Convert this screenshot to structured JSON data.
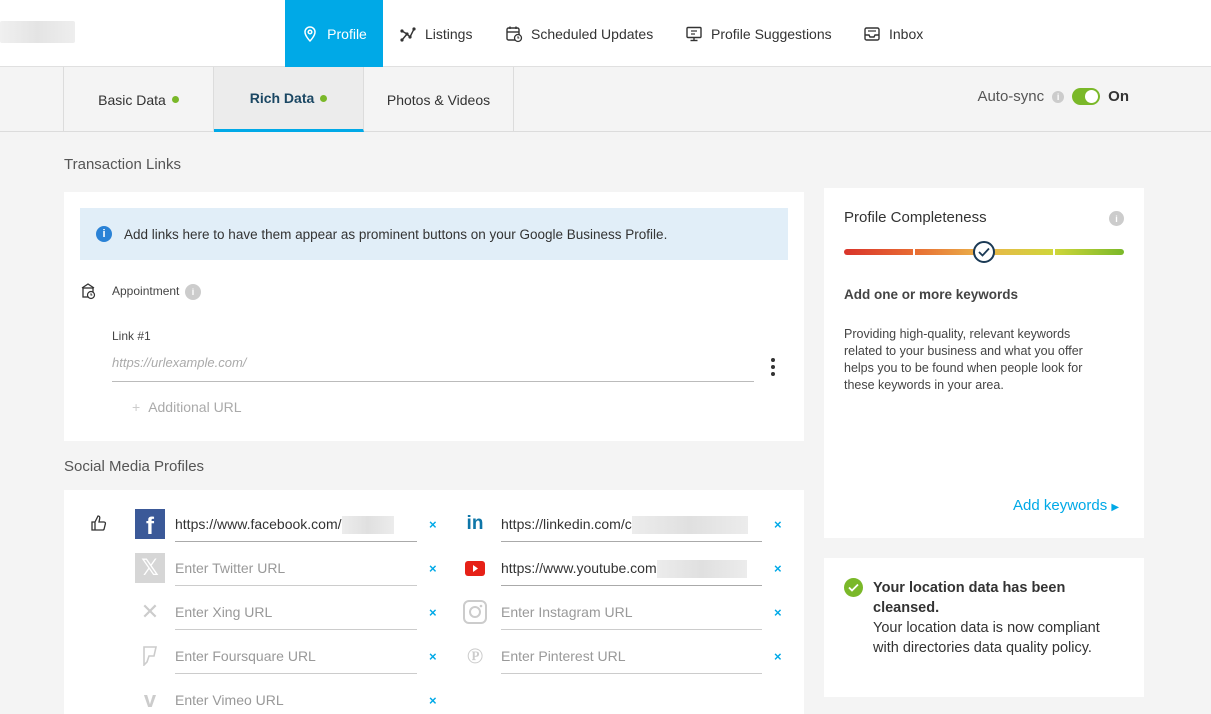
{
  "nav": {
    "items": [
      {
        "label": "Profile",
        "icon": "location-pin-icon"
      },
      {
        "label": "Listings",
        "icon": "network-icon"
      },
      {
        "label": "Scheduled Updates",
        "icon": "calendar-clock-icon"
      },
      {
        "label": "Profile Suggestions",
        "icon": "monitor-suggestion-icon"
      },
      {
        "label": "Inbox",
        "icon": "inbox-icon"
      }
    ]
  },
  "subtabs": [
    {
      "label": "Basic Data"
    },
    {
      "label": "Rich Data"
    },
    {
      "label": "Photos & Videos"
    }
  ],
  "autosync": {
    "label": "Auto-sync",
    "state": "On"
  },
  "transaction": {
    "title": "Transaction Links",
    "banner": "Add links here to have them appear as prominent buttons on your Google Business Profile.",
    "appointment_label": "Appointment",
    "link_label": "Link #1",
    "link_placeholder": "https://urlexample.com/",
    "additional_url": "Additional URL"
  },
  "social": {
    "title": "Social Media Profiles",
    "facebook": "https://www.facebook.com/",
    "linkedin": "https://linkedin.com/c",
    "twitter_placeholder": "Enter Twitter URL",
    "youtube": "https://www.youtube.com",
    "xing_placeholder": "Enter Xing URL",
    "instagram_placeholder": "Enter Instagram URL",
    "foursquare_placeholder": "Enter Foursquare URL",
    "pinterest_placeholder": "Enter Pinterest URL",
    "vimeo_placeholder": "Enter Vimeo URL",
    "remove": "×"
  },
  "completeness": {
    "title": "Profile Completeness",
    "level": 0.5,
    "headline": "Add one or more keywords",
    "body": "Providing high-quality, relevant keywords related to your business and what you offer helps you to be found when people look for these keywords in your area.",
    "cta": "Add keywords"
  },
  "cleansed": {
    "title": "Your location data has been cleansed.",
    "body": "Your location data is now compliant with directories data quality policy."
  },
  "colors": {
    "accent": "#00a9e7",
    "green": "#7ab829",
    "navy": "#1b4763"
  }
}
